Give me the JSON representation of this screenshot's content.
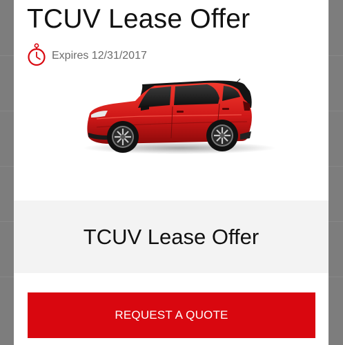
{
  "offer": {
    "title": "TCUV Lease Offer",
    "expires": "Expires 12/31/2017",
    "expiry_icon": "stopwatch-icon",
    "vehicle_image": "red-hatchback-car",
    "section_title": "TCUV Lease Offer",
    "cta_label": "REQUEST A QUOTE"
  },
  "colors": {
    "accent": "#d9070f",
    "title_text": "#111111",
    "muted_text": "#6b6b6b",
    "band_background": "#f3f3f3",
    "overlay": "#7d7d7d"
  }
}
